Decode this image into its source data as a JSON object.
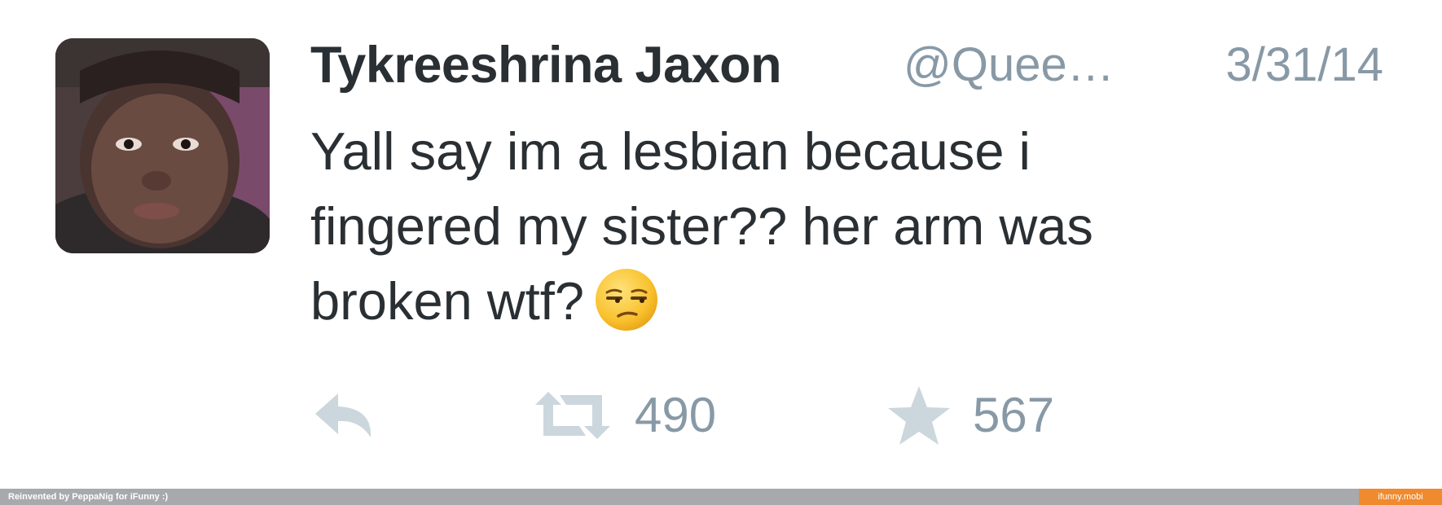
{
  "tweet": {
    "author_name": "Tykreeshrina Jaxon",
    "handle": "@Quee…",
    "date": "3/31/14",
    "text_lines": [
      "Yall say im a lesbian because i",
      "fingered my sister?? her arm was",
      "broken wtf?"
    ],
    "emoji": "unamused-face-emoji",
    "avatar": "profile-photo",
    "actions": {
      "reply_icon": "reply-icon",
      "retweet_icon": "retweet-icon",
      "retweet_count": "490",
      "favorite_icon": "star-icon",
      "favorite_count": "567"
    }
  },
  "footer": {
    "credit": "Reinvented by PeppaNig for iFunny :)",
    "brand": "ifunny.mobi"
  },
  "colors": {
    "text": "#292f33",
    "muted": "#8899a6",
    "icon": "#ccd6dd",
    "footer_bar": "#a7a9ac",
    "brand_orange": "#ef8a2f"
  }
}
